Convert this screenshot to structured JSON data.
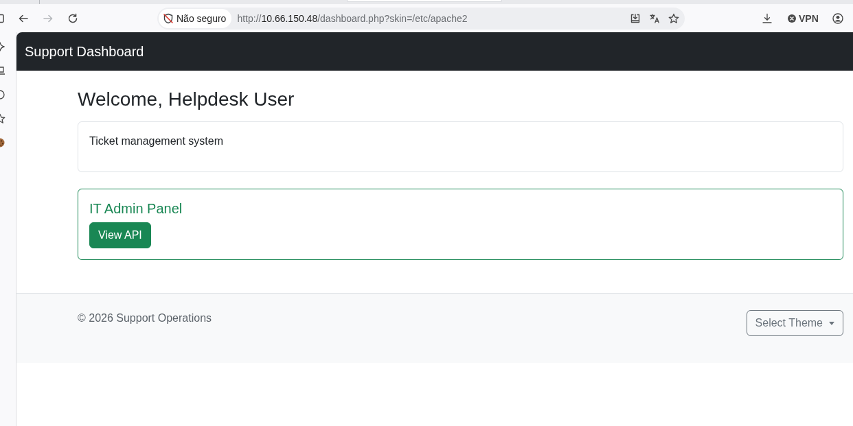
{
  "browser": {
    "nav_buttons": [
      {
        "disabled": false
      },
      {
        "disabled": true
      },
      {
        "disabled": false
      }
    ],
    "address_bar": {
      "security_label": "Não seguro",
      "url": {
        "scheme": "http://",
        "host": "10.66.150.48",
        "path": "/dashboard.php?skin=/etc/apache2"
      }
    },
    "vpn": {
      "label": "VPN",
      "connected": false
    }
  },
  "navbar": {
    "brand": "Support Dashboard"
  },
  "main": {
    "heading": "Welcome, Helpdesk User",
    "cards": [
      {
        "kind": "text",
        "text": "Ticket management system"
      },
      {
        "kind": "action",
        "title": "IT Admin Panel",
        "button": "View API"
      }
    ]
  },
  "footer": {
    "copyright": "© 2026 Support Operations",
    "theme_select": "Select Theme"
  }
}
